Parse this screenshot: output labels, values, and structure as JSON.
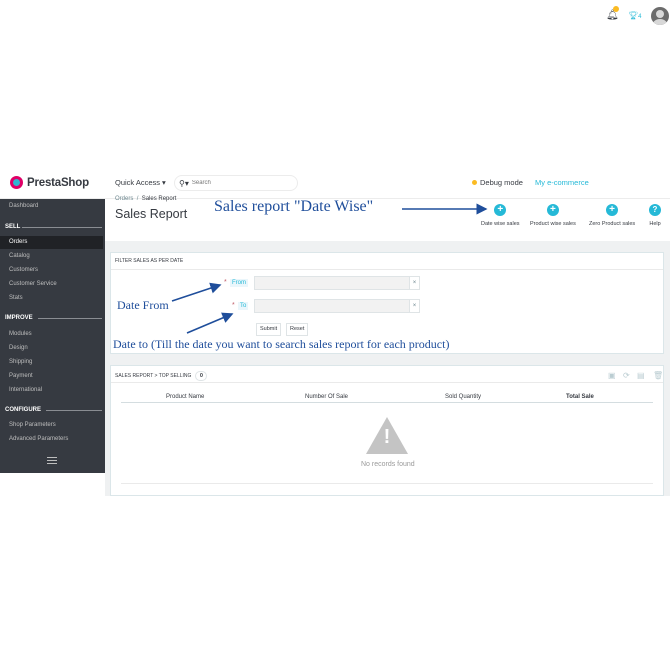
{
  "header": {
    "logo_text": "PrestaShop",
    "quick_access": "Quick Access",
    "search_placeholder": "Search",
    "debug_mode": "Debug mode",
    "store_link": "My e-commerce",
    "notification_count": "2",
    "trophy_count": "4"
  },
  "sidebar": {
    "dashboard": "Dashboard",
    "sections": [
      {
        "title": "SELL",
        "items": [
          "Orders",
          "Catalog",
          "Customers",
          "Customer Service",
          "Stats"
        ]
      },
      {
        "title": "IMPROVE",
        "items": [
          "Modules",
          "Design",
          "Shipping",
          "Payment",
          "International"
        ]
      },
      {
        "title": "CONFIGURE",
        "items": [
          "Shop Parameters",
          "Advanced Parameters"
        ]
      }
    ],
    "active_item": "Orders"
  },
  "page": {
    "breadcrumb": [
      "Orders",
      "Sales Report"
    ],
    "breadcrumb_sep": "/",
    "title": "Sales Report",
    "toolbar": [
      {
        "label": "Date wise sales",
        "icon": "plus-circle-icon"
      },
      {
        "label": "Product wise sales",
        "icon": "plus-circle-icon"
      },
      {
        "label": "Zero Product sales",
        "icon": "plus-circle-icon"
      },
      {
        "label": "Help",
        "icon": "help-circle-icon"
      }
    ]
  },
  "filter_panel": {
    "title": "FILTER SALES AS PER DATE",
    "from_label": "From",
    "to_label": "To",
    "from_value": "",
    "to_value": "",
    "clear": "×",
    "required_mark": "*",
    "submit": "Submit",
    "reset": "Reset"
  },
  "report_panel": {
    "title": "SALES REPORT > TOP SELLING",
    "count": "0",
    "columns": [
      "Product Name",
      "Number Of Sale",
      "Sold Quantity",
      "Total Sale"
    ],
    "empty_icon": "!",
    "empty_text": "No records found"
  },
  "annotations": {
    "date_wise": "Sales report \"Date Wise\"",
    "date_from": "Date From",
    "date_to": "Date to (Till the date you want to search sales report for each product)"
  },
  "colors": {
    "accent": "#25b9d7",
    "sidebar_bg": "#363a41",
    "sidebar_active": "#202226",
    "annotation": "#1f4e9b",
    "required": "#c05c67",
    "logo_pink": "#df0067"
  }
}
